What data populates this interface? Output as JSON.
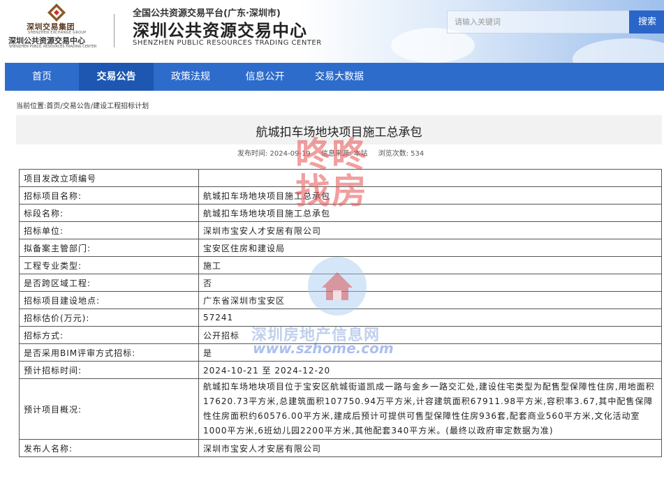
{
  "header": {
    "group_name": "深圳交易集团",
    "group_name_en": "SHENZHEN EXCHANGE GROUP",
    "center_name": "深圳公共资源交易中心",
    "center_name_en": "SHENZHEN PUBLIC RESOURCES TRADING CENTER",
    "platform_title": "全国公共资源交易平台(广东·深圳市)",
    "main_title": "深圳公共资源交易中心",
    "main_title_en": "SHENZHEN PUBLIC RESOURCES TRADING CENTER",
    "search_placeholder": "请输入关键词",
    "search_label": "搜索"
  },
  "nav": {
    "items": [
      {
        "label": "首页"
      },
      {
        "label": "交易公告",
        "active": true
      },
      {
        "label": "政策法规"
      },
      {
        "label": "信息公开"
      },
      {
        "label": "交易大数据"
      }
    ]
  },
  "breadcrumb": "当前位置:首页/交易公告/建设工程招标计划",
  "article": {
    "title": "航城扣车场地块项目施工总承包",
    "publish_time": "发布时间: 2024-09-19",
    "source": "信息来源: 本站",
    "views": "浏览次数: 534"
  },
  "table": [
    {
      "key": "项目发改立项编号",
      "value": ""
    },
    {
      "key": "招标项目名称:",
      "value": "航城扣车场地块项目施工总承包"
    },
    {
      "key": "标段名称:",
      "value": "航城扣车场地块项目施工总承包"
    },
    {
      "key": "招标单位:",
      "value": "深圳市宝安人才安居有限公司"
    },
    {
      "key": "拟备案主管部门:",
      "value": "宝安区住房和建设局"
    },
    {
      "key": "工程专业类型:",
      "value": "施工"
    },
    {
      "key": "是否跨区域工程:",
      "value": "否"
    },
    {
      "key": "招标项目建设地点:",
      "value": "广东省深圳市宝安区"
    },
    {
      "key": "招标估价(万元):",
      "value": "57241"
    },
    {
      "key": "招标方式:",
      "value": "公开招标"
    },
    {
      "key": "是否采用BIM评审方式招标:",
      "value": "是"
    },
    {
      "key": "预计招标时间:",
      "value": "2024-10-21 至 2024-12-20"
    },
    {
      "key": "预计项目概况:",
      "value": "航城扣车场地块项目位于宝安区航城街道凯成一路与金乡一路交汇处,建设住宅类型为配售型保障性住房,用地面积17620.73平方米,总建筑面积107750.94万平方米,计容建筑面积67911.98平方米,容积率3.67,其中配售保障性住房面积约60576.00平方米,建成后预计可提供可售型保障性住房936套,配套商业560平方米,文化活动室1000平方米,6班幼儿园2200平方米,其他配套340平方米。(最终以政府审定数据为准)",
      "tall": true
    },
    {
      "key": "发布人名称:",
      "value": "深圳市宝安人才安居有限公司"
    }
  ],
  "watermarks": {
    "box_text": "咚咚找房",
    "site_name": "深圳房地产信息网",
    "site_url": "www.szhome.com"
  },
  "colors": {
    "nav_bg": "#2e6ccc",
    "nav_active": "#1d57b2",
    "search_btn": "#2a66c8",
    "title_band": "#f2f2f2"
  }
}
